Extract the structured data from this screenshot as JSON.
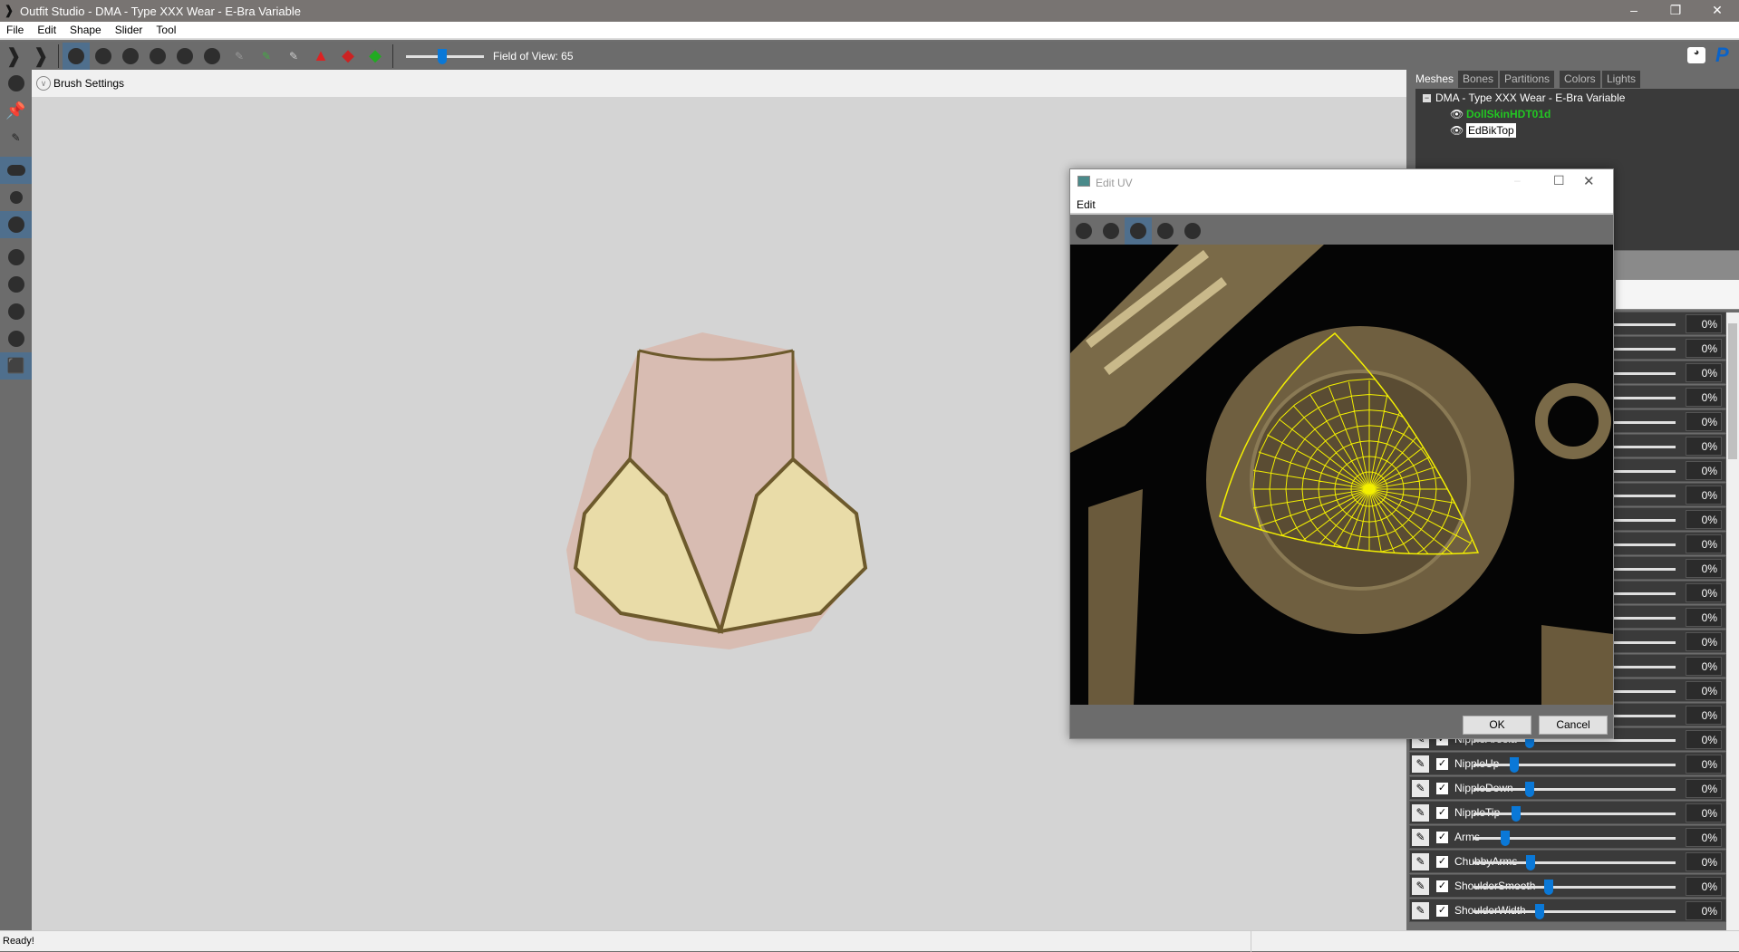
{
  "window": {
    "title": "Outfit Studio - DMA - Type XXX Wear - E-Bra Variable"
  },
  "menu": [
    "File",
    "Edit",
    "Shape",
    "Slider",
    "Tool"
  ],
  "toolbar": {
    "fov_label": "Field of View: 65",
    "fov_value": 65
  },
  "brush_settings": "Brush Settings",
  "tabs": [
    "Meshes",
    "Bones",
    "Partitions",
    "Colors",
    "Lights"
  ],
  "active_tab": "Meshes",
  "tree": {
    "root": "DMA - Type XXX Wear - E-Bra Variable",
    "items": [
      {
        "label": "DollSkinHDT01d",
        "color": "#22c722"
      },
      {
        "label": "EdBikTop",
        "selected": true
      }
    ]
  },
  "sliders": [
    {
      "name": "",
      "value": "0%"
    },
    {
      "name": "",
      "value": "0%"
    },
    {
      "name": "",
      "value": "0%"
    },
    {
      "name": "",
      "value": "0%"
    },
    {
      "name": "",
      "value": "0%"
    },
    {
      "name": "",
      "value": "0%"
    },
    {
      "name": "",
      "value": "0%"
    },
    {
      "name": "",
      "value": "0%"
    },
    {
      "name": "",
      "value": "0%"
    },
    {
      "name": "",
      "value": "0%"
    },
    {
      "name": "",
      "value": "0%"
    },
    {
      "name": "",
      "value": "0%"
    },
    {
      "name": "",
      "value": "0%"
    },
    {
      "name": "",
      "value": "0%"
    },
    {
      "name": "",
      "value": "0%"
    },
    {
      "name": "",
      "value": "0%"
    },
    {
      "name": "",
      "value": "0%"
    },
    {
      "name": "NippleAreola",
      "value": "0%"
    },
    {
      "name": "NippleUp",
      "value": "0%"
    },
    {
      "name": "NippleDown",
      "value": "0%"
    },
    {
      "name": "NippleTip",
      "value": "0%"
    },
    {
      "name": "Arms",
      "value": "0%"
    },
    {
      "name": "ChubbyArms",
      "value": "0%"
    },
    {
      "name": "ShoulderSmooth",
      "value": "0%"
    },
    {
      "name": "ShoulderWidth",
      "value": "0%"
    }
  ],
  "dialog": {
    "title": "Edit UV",
    "menu": "Edit",
    "ok": "OK",
    "cancel": "Cancel"
  },
  "status": "Ready!",
  "accent": "#0a78d7"
}
